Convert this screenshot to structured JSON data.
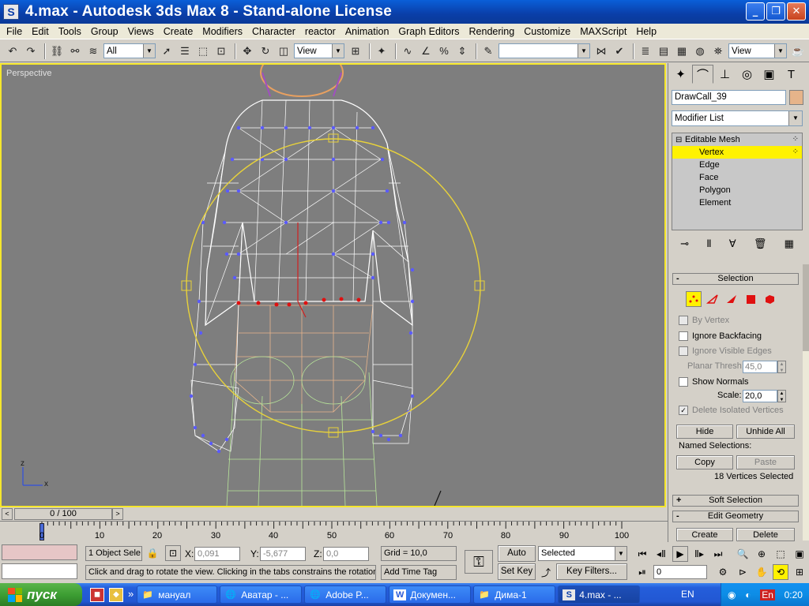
{
  "window": {
    "title": "4.max - Autodesk 3ds Max 8  - Stand-alone License",
    "app_icon": "S",
    "minimize": "_",
    "maximize": "❐",
    "close": "✕"
  },
  "menu": [
    "File",
    "Edit",
    "Tools",
    "Group",
    "Views",
    "Create",
    "Modifiers",
    "Character",
    "reactor",
    "Animation",
    "Graph Editors",
    "Rendering",
    "Customize",
    "MAXScript",
    "Help"
  ],
  "toolbar": {
    "selection_filter": "All",
    "ref_coord": "View",
    "named_sel": "",
    "view_right": "View"
  },
  "viewport": {
    "label": "Perspective",
    "axis_x": "x",
    "axis_z": "z"
  },
  "panel": {
    "object_name": "DrawCall_39",
    "object_color": "#e6b48a",
    "modifier_list": "Modifier List",
    "stack": [
      {
        "label": "Editable Mesh",
        "prefix": "⊟",
        "selected": false
      },
      {
        "label": "Vertex",
        "prefix": "",
        "selected": true
      },
      {
        "label": "Edge",
        "prefix": "",
        "selected": false
      },
      {
        "label": "Face",
        "prefix": "",
        "selected": false
      },
      {
        "label": "Polygon",
        "prefix": "",
        "selected": false
      },
      {
        "label": "Element",
        "prefix": "",
        "selected": false
      }
    ],
    "selection": {
      "header": "Selection",
      "sign": "-",
      "by_vertex": "By Vertex",
      "ignore_backfacing": "Ignore Backfacing",
      "ignore_visible_edges": "Ignore Visible Edges",
      "planar_thresh_label": "Planar Thresh:",
      "planar_thresh": "45,0",
      "show_normals": "Show Normals",
      "scale_label": "Scale:",
      "scale": "20,0",
      "delete_isolated": "Delete Isolated Vertices",
      "check": "✓",
      "hide": "Hide",
      "unhide_all": "Unhide All",
      "named_selections": "Named Selections:",
      "copy": "Copy",
      "paste": "Paste",
      "count": "18 Vertices Selected"
    },
    "soft_selection": {
      "header": "Soft Selection",
      "sign": "+"
    },
    "edit_geometry": {
      "header": "Edit Geometry",
      "sign": "-",
      "create": "Create",
      "delete": "Delete"
    }
  },
  "timeline": {
    "frame": "0 / 100",
    "prev": "<",
    "next": ">",
    "ticks": [
      "0",
      "10",
      "20",
      "30",
      "40",
      "50",
      "60",
      "70",
      "80",
      "90",
      "100"
    ]
  },
  "status": {
    "objects": "1 Object Sele",
    "x_label": "X:",
    "x": "0,091",
    "y_label": "Y:",
    "y": "-5,677",
    "z_label": "Z:",
    "z": "0,0",
    "grid": "Grid = 10,0",
    "prompt": "Click and drag to rotate the view.  Clicking in the tabs constrains the rotation",
    "add_time_tag": "Add Time Tag",
    "auto_key": "Auto Key",
    "set_key": "Set Key",
    "key_mode": "Selected",
    "key_filters": "Key Filters...",
    "current_frame": "0"
  },
  "taskbar": {
    "start": "пуск",
    "more": "»",
    "tasks": [
      {
        "label": "мануал",
        "icon": "📁",
        "active": false
      },
      {
        "label": "Аватар - ...",
        "icon": "🌐",
        "active": false
      },
      {
        "label": "Adobe P...",
        "icon": "🌐",
        "active": false
      },
      {
        "label": "Докумен...",
        "icon": "W",
        "active": false
      },
      {
        "label": "Дима-1",
        "icon": "📁",
        "active": false
      },
      {
        "label": "4.max - ...",
        "icon": "S",
        "active": true
      }
    ],
    "lang": "EN",
    "clock": "0:20"
  }
}
